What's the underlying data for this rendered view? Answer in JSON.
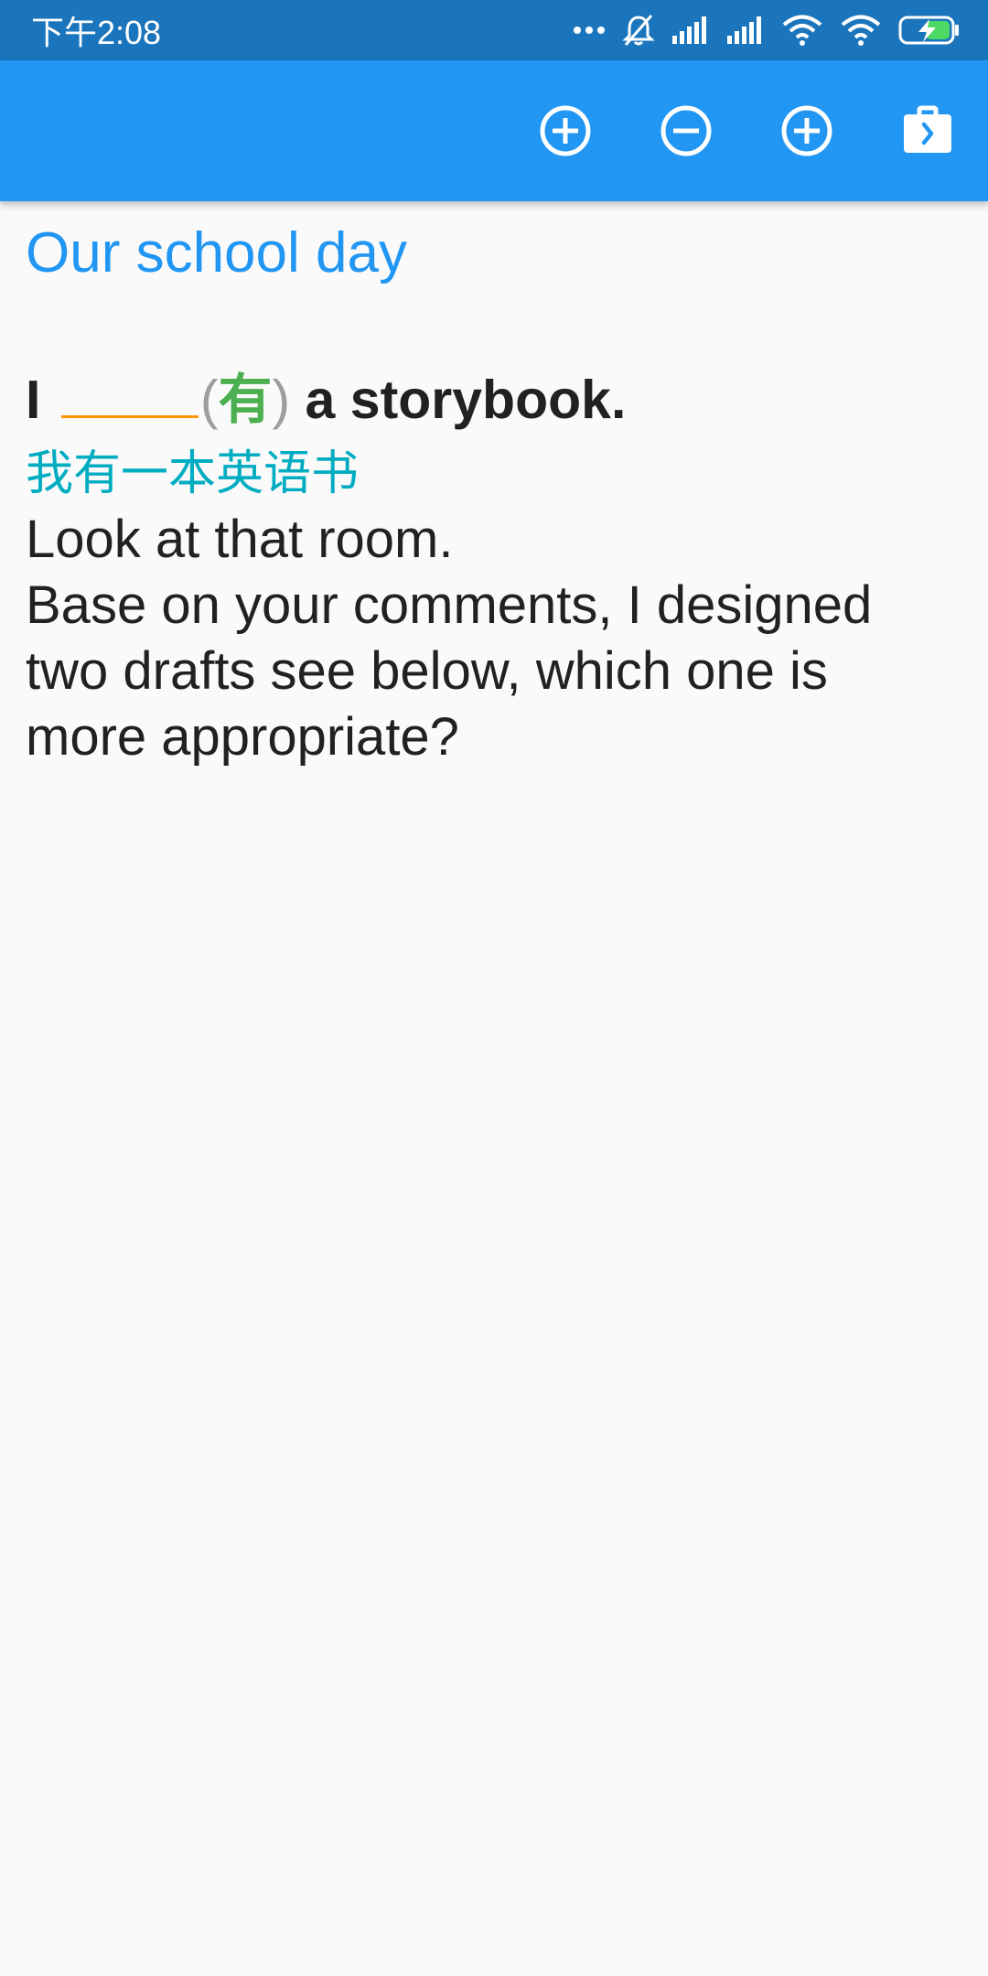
{
  "status_bar": {
    "time": "下午2:08",
    "icons": [
      "more-dots-icon",
      "mute-bell-icon",
      "signal-icon",
      "signal-icon",
      "wifi-icon",
      "wifi-icon",
      "battery-charging-icon"
    ]
  },
  "app_bar": {
    "background": "#2196f3",
    "actions": [
      "add-circle-icon",
      "remove-circle-icon",
      "add-circle-icon",
      "briefcase-next-icon"
    ]
  },
  "lesson": {
    "title": "Our school day",
    "sentence": {
      "start": "I",
      "paren_open": "(",
      "hint": "有",
      "paren_close": ")",
      "end": "a storybook."
    },
    "translation": "我有一本英语书",
    "lines": [
      "Look at that room.",
      "Base on your comments, I designed two drafts see below, which one is more appropriate?"
    ]
  },
  "colors": {
    "title": "#2196f3",
    "blank": "#ff9800",
    "hint": "#4caf50",
    "translation": "#00acc1",
    "status_bar": "#1b75bc"
  }
}
